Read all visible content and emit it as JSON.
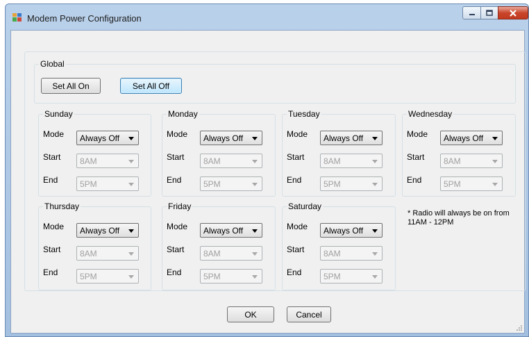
{
  "window": {
    "title": "Modem Power Configuration"
  },
  "global": {
    "label": "Global",
    "set_all_on": "Set All On",
    "set_all_off": "Set All Off"
  },
  "labels": {
    "mode": "Mode",
    "start": "Start",
    "end": "End"
  },
  "days": [
    {
      "name": "Sunday",
      "mode": "Always Off",
      "start": "8AM",
      "end": "5PM"
    },
    {
      "name": "Monday",
      "mode": "Always Off",
      "start": "8AM",
      "end": "5PM"
    },
    {
      "name": "Tuesday",
      "mode": "Always Off",
      "start": "8AM",
      "end": "5PM"
    },
    {
      "name": "Wednesday",
      "mode": "Always Off",
      "start": "8AM",
      "end": "5PM"
    },
    {
      "name": "Thursday",
      "mode": "Always Off",
      "start": "8AM",
      "end": "5PM"
    },
    {
      "name": "Friday",
      "mode": "Always Off",
      "start": "8AM",
      "end": "5PM"
    },
    {
      "name": "Saturday",
      "mode": "Always Off",
      "start": "8AM",
      "end": "5PM"
    }
  ],
  "note": "* Radio will always be on from 11AM - 12PM",
  "footer": {
    "ok": "OK",
    "cancel": "Cancel"
  }
}
